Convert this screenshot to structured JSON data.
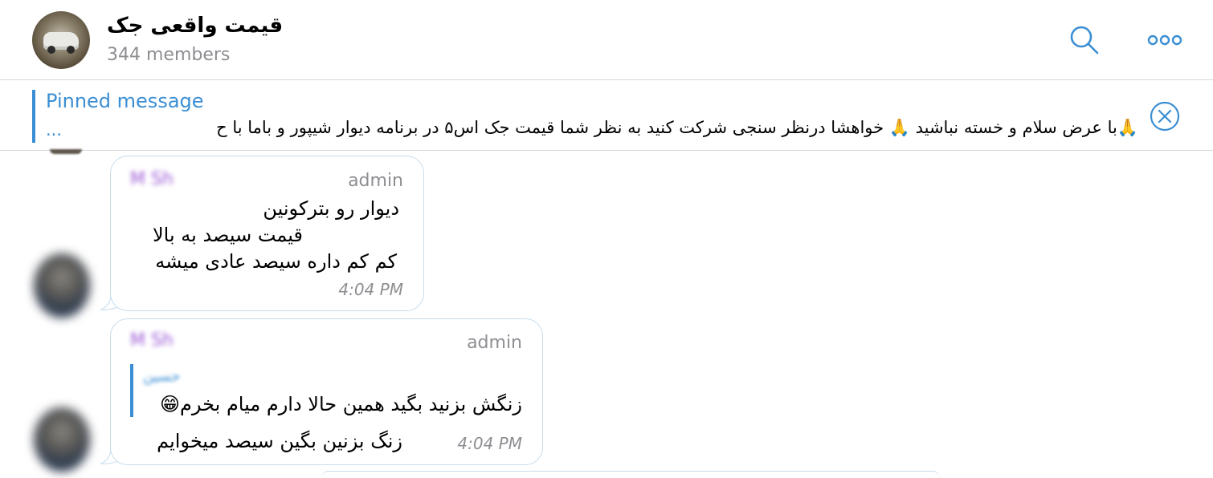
{
  "header": {
    "title": "قیمت واقعی جک",
    "members": "344 members"
  },
  "pinned": {
    "title": "Pinned message",
    "text": "🙏با عرض سلام و خسته نباشید 🙏 خواهشا درنظر سنجی شرکت کنید  به نظر شما قیمت جک اس۵ در برنامه دیوار شیپور و باما با ح",
    "ellipsis": "..."
  },
  "messages": [
    {
      "sender": "M Sh",
      "role": "admin",
      "lines": [
        "دیوار رو بترکونین",
        "قیمت سیصد به بالا",
        "کم کم داره سیصد عادی میشه"
      ],
      "time": "4:04 PM"
    },
    {
      "sender": "M Sh",
      "role": "admin",
      "reply_name": "حسین",
      "reply_text": "زنگش بزنید بگید همین حالا دارم میام بخرم😁",
      "text": "زنگ بزنین بگین سیصد میخوایم",
      "time": "4:04 PM"
    }
  ],
  "colors": {
    "accent": "#3b8ed3",
    "bubble_border": "#c6dcec",
    "muted": "#8e8e93",
    "sender": "#9b59d6"
  },
  "icons": [
    "search-icon",
    "more-icon",
    "close-icon"
  ]
}
